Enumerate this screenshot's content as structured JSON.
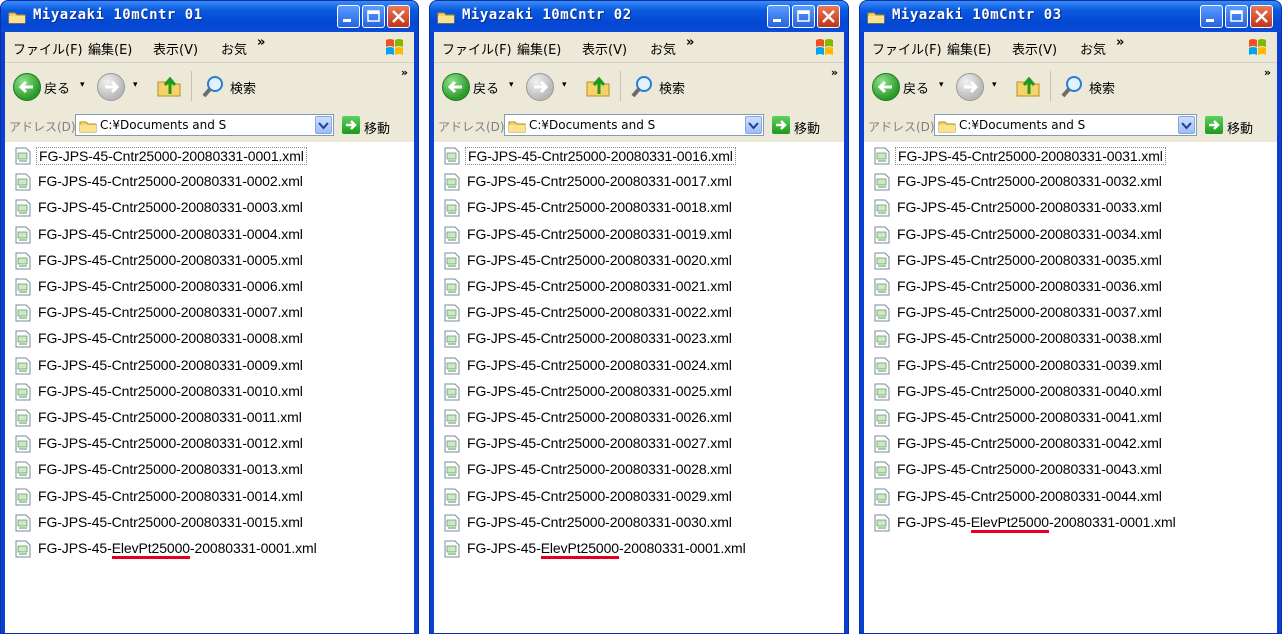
{
  "windows": [
    {
      "title": "Miyazaki 10mCntr 01",
      "files": [
        "FG-JPS-45-Cntr25000-20080331-0001.xml",
        "FG-JPS-45-Cntr25000-20080331-0002.xml",
        "FG-JPS-45-Cntr25000-20080331-0003.xml",
        "FG-JPS-45-Cntr25000-20080331-0004.xml",
        "FG-JPS-45-Cntr25000-20080331-0005.xml",
        "FG-JPS-45-Cntr25000-20080331-0006.xml",
        "FG-JPS-45-Cntr25000-20080331-0007.xml",
        "FG-JPS-45-Cntr25000-20080331-0008.xml",
        "FG-JPS-45-Cntr25000-20080331-0009.xml",
        "FG-JPS-45-Cntr25000-20080331-0010.xml",
        "FG-JPS-45-Cntr25000-20080331-0011.xml",
        "FG-JPS-45-Cntr25000-20080331-0012.xml",
        "FG-JPS-45-Cntr25000-20080331-0013.xml",
        "FG-JPS-45-Cntr25000-20080331-0014.xml",
        "FG-JPS-45-Cntr25000-20080331-0015.xml"
      ],
      "highlight_file": {
        "pre": "FG-JPS-45-",
        "mark": "ElevPt25000",
        "post": "-20080331-0001.xml"
      }
    },
    {
      "title": "Miyazaki 10mCntr 02",
      "files": [
        "FG-JPS-45-Cntr25000-20080331-0016.xml",
        "FG-JPS-45-Cntr25000-20080331-0017.xml",
        "FG-JPS-45-Cntr25000-20080331-0018.xml",
        "FG-JPS-45-Cntr25000-20080331-0019.xml",
        "FG-JPS-45-Cntr25000-20080331-0020.xml",
        "FG-JPS-45-Cntr25000-20080331-0021.xml",
        "FG-JPS-45-Cntr25000-20080331-0022.xml",
        "FG-JPS-45-Cntr25000-20080331-0023.xml",
        "FG-JPS-45-Cntr25000-20080331-0024.xml",
        "FG-JPS-45-Cntr25000-20080331-0025.xml",
        "FG-JPS-45-Cntr25000-20080331-0026.xml",
        "FG-JPS-45-Cntr25000-20080331-0027.xml",
        "FG-JPS-45-Cntr25000-20080331-0028.xml",
        "FG-JPS-45-Cntr25000-20080331-0029.xml",
        "FG-JPS-45-Cntr25000-20080331-0030.xml"
      ],
      "highlight_file": {
        "pre": "FG-JPS-45-",
        "mark": "ElevPt25000",
        "post": "-20080331-0001.xml"
      }
    },
    {
      "title": "Miyazaki 10mCntr 03",
      "files": [
        "FG-JPS-45-Cntr25000-20080331-0031.xml",
        "FG-JPS-45-Cntr25000-20080331-0032.xml",
        "FG-JPS-45-Cntr25000-20080331-0033.xml",
        "FG-JPS-45-Cntr25000-20080331-0034.xml",
        "FG-JPS-45-Cntr25000-20080331-0035.xml",
        "FG-JPS-45-Cntr25000-20080331-0036.xml",
        "FG-JPS-45-Cntr25000-20080331-0037.xml",
        "FG-JPS-45-Cntr25000-20080331-0038.xml",
        "FG-JPS-45-Cntr25000-20080331-0039.xml",
        "FG-JPS-45-Cntr25000-20080331-0040.xml",
        "FG-JPS-45-Cntr25000-20080331-0041.xml",
        "FG-JPS-45-Cntr25000-20080331-0042.xml",
        "FG-JPS-45-Cntr25000-20080331-0043.xml",
        "FG-JPS-45-Cntr25000-20080331-0044.xml"
      ],
      "highlight_file": {
        "pre": "FG-JPS-45-",
        "mark": "ElevPt25000",
        "post": "-20080331-0001.xml"
      }
    }
  ],
  "menu": {
    "file": "ファイル(F)",
    "edit": "編集(E)",
    "view": "表示(V)",
    "favorites": "お気",
    "more": "»"
  },
  "toolbar": {
    "back_label": "戻る",
    "dropdown": "▾",
    "search_label": "検索",
    "more": "»"
  },
  "address": {
    "label": "アドレス(D)",
    "value": "C:¥Documents and S",
    "go_label": "移動"
  },
  "colors": {
    "titlebar": "#0a5ae0",
    "chrome": "#ece9d8",
    "highlight_underline": "#e3001e",
    "close_button": "#c0341a"
  },
  "icons": {
    "title": "folder-icon",
    "back": "back-arrow-icon",
    "forward": "forward-arrow-icon",
    "up": "up-folder-icon",
    "search": "search-icon",
    "go": "go-arrow-icon",
    "file": "xml-file-icon",
    "logo": "windows-logo-icon"
  }
}
